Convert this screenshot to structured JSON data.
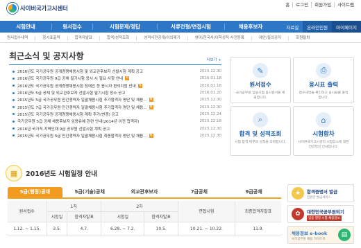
{
  "header": {
    "site_title": "사이버국가고시센터",
    "utils": [
      "홈",
      "로그인",
      "회원가입",
      "사이트맵"
    ]
  },
  "nav": {
    "items": [
      "시험안내",
      "원서접수",
      "시험문제/정답",
      "서류전형/면접시험",
      "채용후보자"
    ],
    "right": [
      "자료실",
      "온라인민원",
      "마이페이지"
    ]
  },
  "subnav": [
    "원서접수내역",
    "응시표출력",
    "합격자발표",
    "합격/성적조회",
    "성적사전공개/이의제기",
    "영어/한국사/어학성적 사전등록",
    "제안/질의공지",
    "회원탈퇴"
  ],
  "notice": {
    "title": "최근소식 및 공지사항",
    "more": "더보기 +",
    "items": [
      {
        "text": "2016년도 국가공무원 공개경쟁채용시험 및 외교관후보자 선발시험 계획 공고",
        "date": "2015.12.30",
        "new": false
      },
      {
        "text": "2016년도 국가공무원 9급 공채 필기시험 응시 시 필요 사항 안내",
        "date": "2016.01.18",
        "new": true
      },
      {
        "text": "2016년도 국가공무원 공개경쟁채용시험 장애인 등 응시자 편의지원 안내",
        "date": "2016.01.18",
        "new": true
      },
      {
        "text": "2016년도 5급 공채 및 외교관후보자 선발시험 필기시험 장소 공고",
        "date": "2016.01.20",
        "new": false
      },
      {
        "text": "2015년도 5급 국가공무원 민간경력자 일괄채용시험 추가합격자 명단 및 채용...",
        "date": "2015.12.30",
        "new": true
      },
      {
        "text": "2015년도 7급 국가공무원 민간경력자 일괄채용시험 추가합격자 명단 및 채용...",
        "date": "2015.12.30",
        "new": true
      },
      {
        "text": "2015년도 국가공무원 공개경쟁채용시험 계획 추가(변경) 공고",
        "date": "2015.12.24",
        "new": false
      },
      {
        "text": "국가공무원 5급 공채 채용후보자 임용유예 관련 안내(2014년 이전 합격자)",
        "date": "2015.12.18",
        "new": false
      },
      {
        "text": "2016년 국가직 지역인재 9급 공무원 선발시험 계획 공고",
        "date": "2015.12.30",
        "new": false
      },
      {
        "text": "2015년도 국가공무원 5급 민간경력자 일괄채용시험 최종합격자 명단 및 채용...",
        "date": "2015.12.30",
        "new": true
      }
    ]
  },
  "quick": [
    {
      "title": "원서접수",
      "desc": "국가공무원 임용시험 응시원서를 제출합니다."
    },
    {
      "title": "응시표 출력",
      "desc": "접수내역을 확인하고 응시표를 출력합니다."
    },
    {
      "title": "합격 및 성적조회",
      "desc": "시험 합격 여부와 성적을 조회합니다."
    },
    {
      "title": "시험함차",
      "desc": "사이버국가고시센터 시험장소에 대한 전반적인 안내입니다."
    }
  ],
  "schedule": {
    "title": "2016년도 시험일정 안내",
    "tabs": [
      "5급(행정)공채",
      "5급(기술)공채",
      "외교관후보자",
      "7급공채",
      "9급공채"
    ],
    "headers": {
      "apply": "원서접수",
      "first": "1차",
      "second": "2차",
      "interview": "면접시험",
      "final": "최종합격자발표",
      "exam": "시험일",
      "result": "합격자발표"
    },
    "row": [
      "1.12. ~ 1.15.",
      "3.5.",
      "4.7.",
      "6.28. ~ 7.2.",
      "10.5.",
      "10.21. ~ 10.22.",
      "11.9."
    ]
  },
  "banners": [
    {
      "title": "합격증명서 발급",
      "sub": "민원안 발급서비스"
    },
    {
      "title": "대한민국공무원되기",
      "sub": "임용 행정 시험 채용정보"
    },
    {
      "title": "채용정보 e-book",
      "sub": "국가공무원 채용 가이드북"
    }
  ]
}
